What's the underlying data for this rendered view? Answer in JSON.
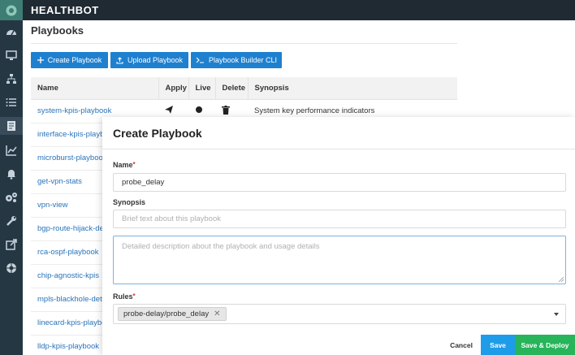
{
  "app": {
    "brand": "HEALTHBOT"
  },
  "page": {
    "title": "Playbooks"
  },
  "toolbar": {
    "create_label": "Create Playbook",
    "upload_label": "Upload Playbook",
    "cli_label": "Playbook Builder CLI"
  },
  "table": {
    "headers": [
      "Name",
      "Apply",
      "Live",
      "Delete",
      "Synopsis"
    ],
    "rows": [
      {
        "name": "system-kpis-playbook",
        "synopsis": "System key performance indicators"
      },
      {
        "name": "interface-kpis-playbook",
        "synopsis": ""
      },
      {
        "name": "microburst-playbook",
        "synopsis": ""
      },
      {
        "name": "get-vpn-stats",
        "synopsis": ""
      },
      {
        "name": "vpn-view",
        "synopsis": ""
      },
      {
        "name": "bgp-route-hijack-detection",
        "synopsis": ""
      },
      {
        "name": "rca-ospf-playbook",
        "synopsis": ""
      },
      {
        "name": "chip-agnostic-kpis",
        "synopsis": ""
      },
      {
        "name": "mpls-blackhole-detection",
        "synopsis": ""
      },
      {
        "name": "linecard-kpis-playbook",
        "synopsis": ""
      },
      {
        "name": "lldp-kpis-playbook",
        "synopsis": ""
      }
    ]
  },
  "modal": {
    "title": "Create Playbook",
    "name_label": "Name",
    "name_value": "probe_delay",
    "synopsis_label": "Synopsis",
    "synopsis_placeholder": "Brief text about this playbook",
    "description_placeholder": "Detailed description about the playbook and usage details",
    "rules_label": "Rules",
    "rules_selected": "probe-delay/probe_delay",
    "required_mark": "*",
    "cancel_label": "Cancel",
    "save_label": "Save",
    "save_deploy_label": "Save & Deploy"
  },
  "colors": {
    "primary": "#1f80cf",
    "save": "#1e9be9",
    "save_deploy": "#27b45a",
    "sidebar": "#253743",
    "topbar": "#1f2a33"
  },
  "icons": {
    "sidebar": [
      "dashboard-icon",
      "monitor-icon",
      "topology-icon",
      "list-icon",
      "playbook-icon",
      "chart-icon",
      "bell-icon",
      "settings-icon",
      "wrench-icon",
      "external-link-icon",
      "help-icon"
    ]
  }
}
